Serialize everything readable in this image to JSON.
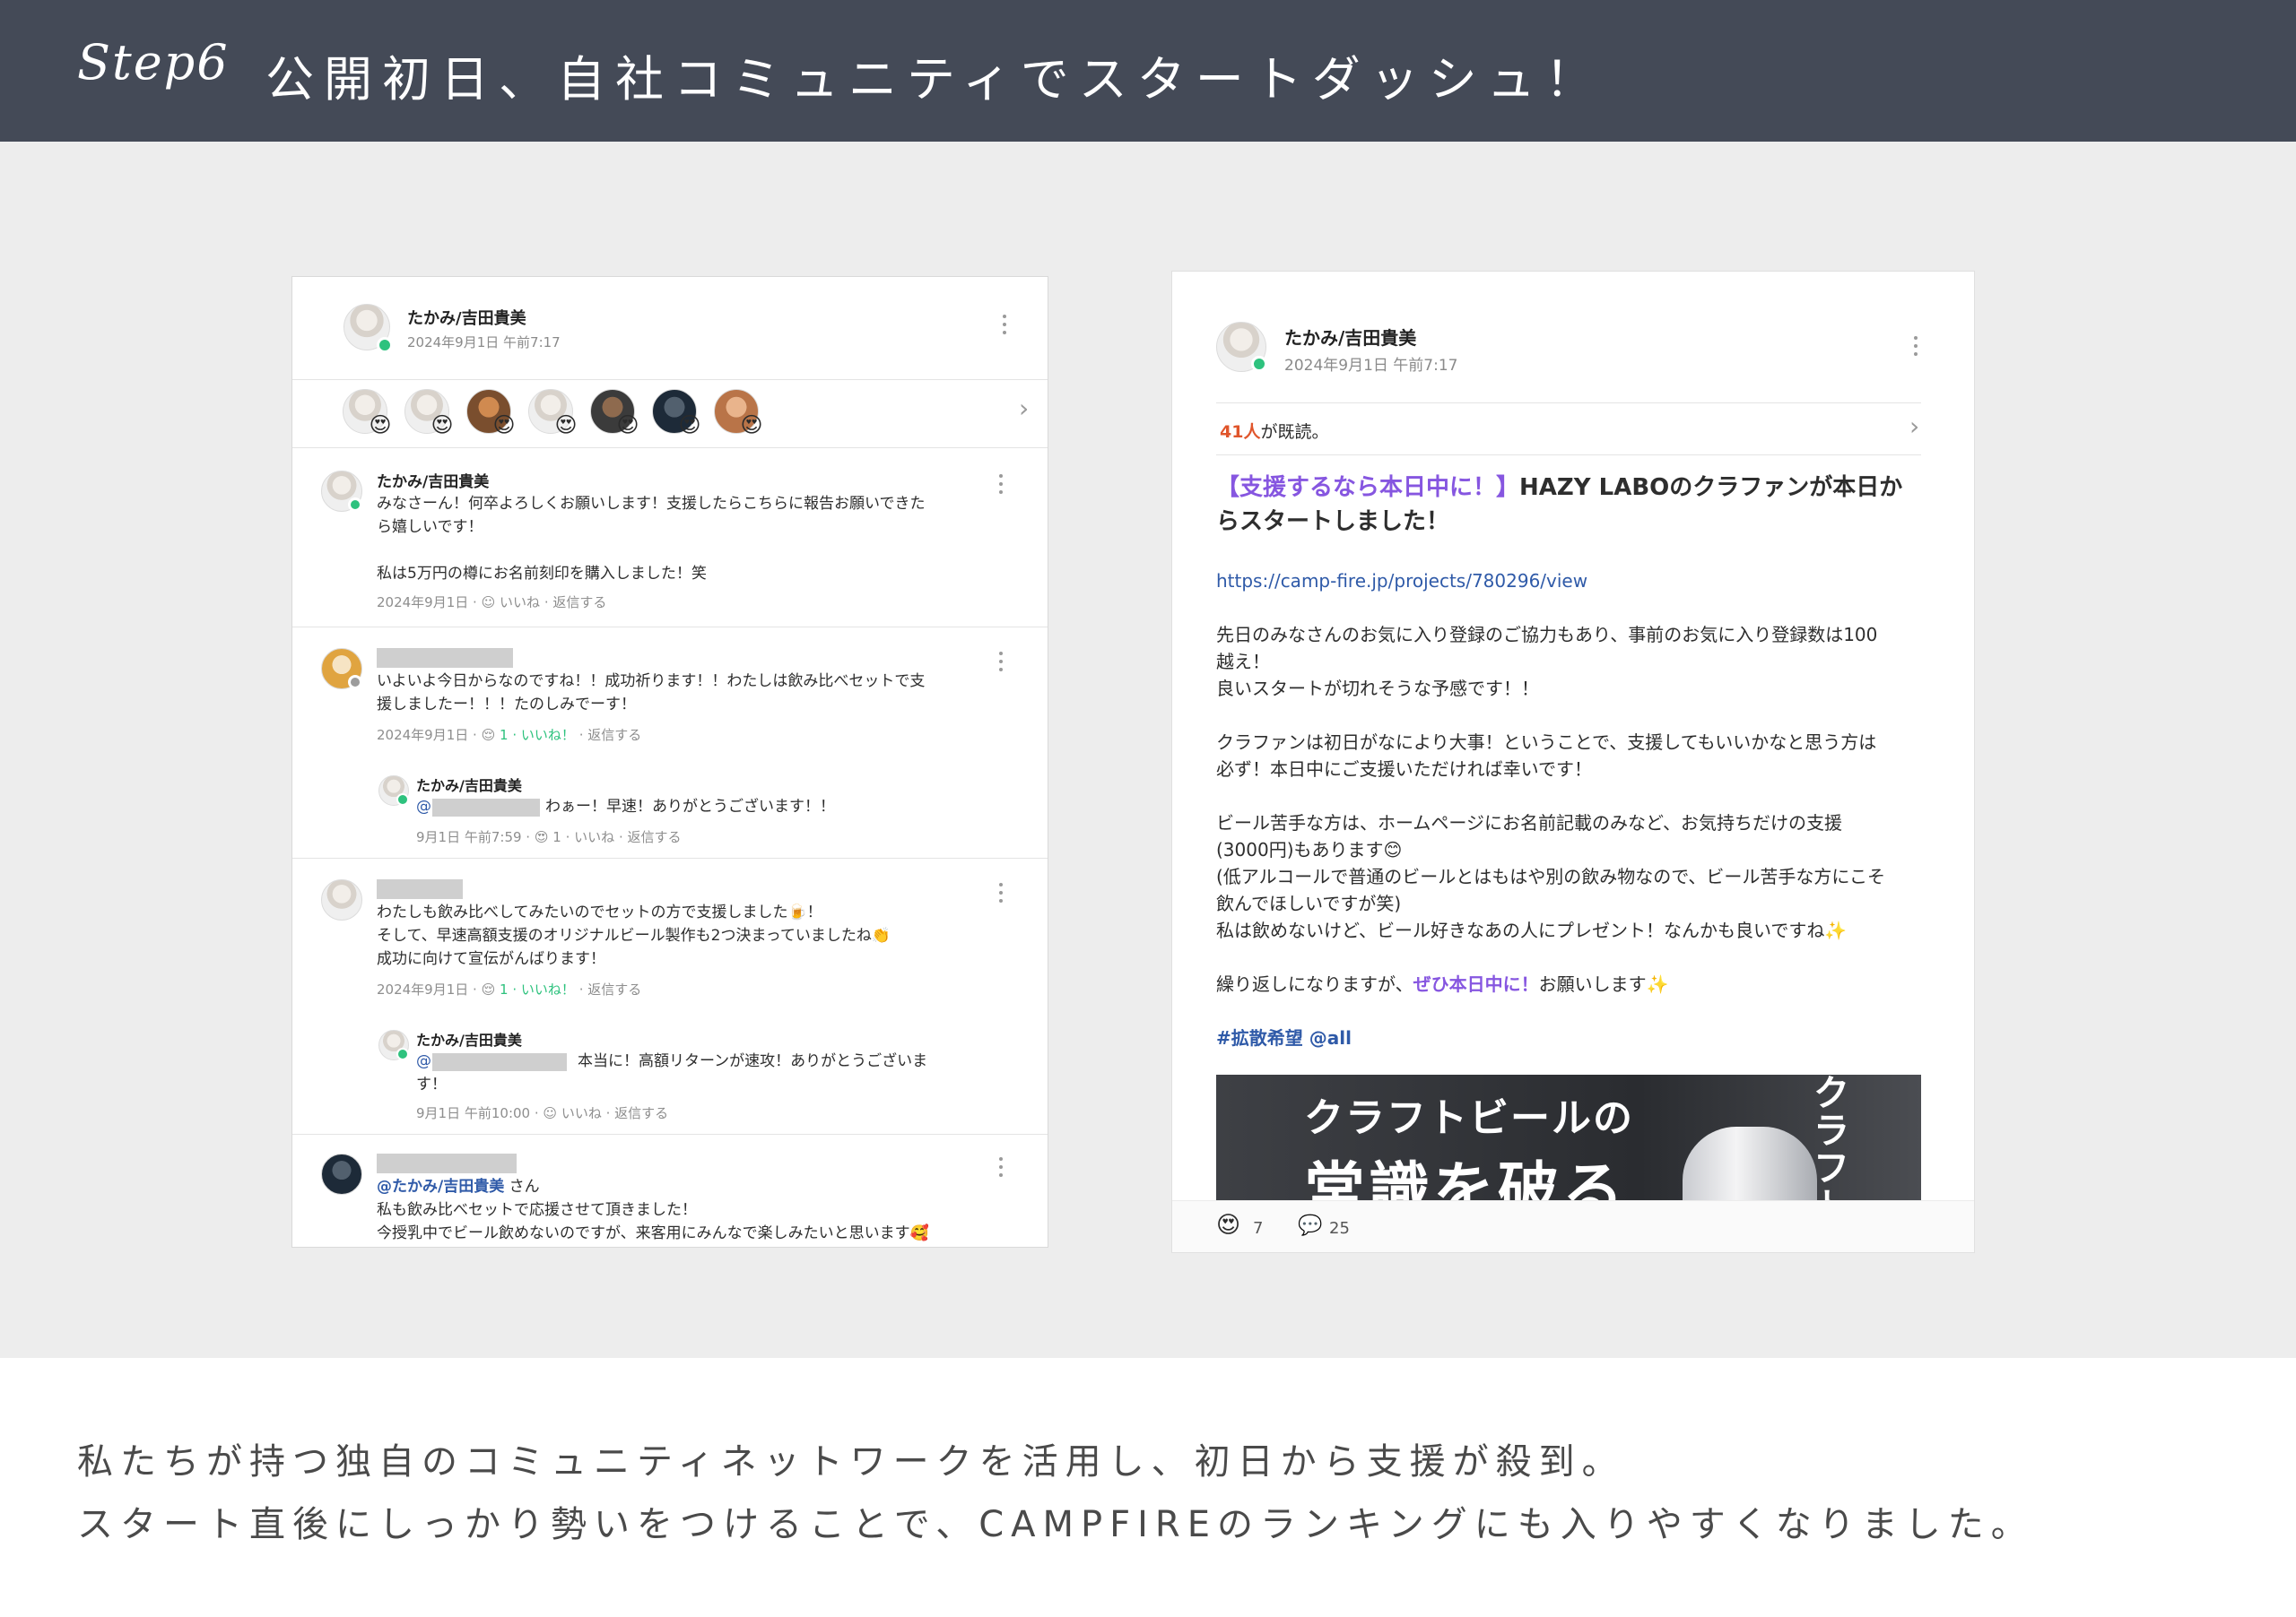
{
  "header": {
    "step": "Step6",
    "title": "公開初日、自社コミュニティでスタートダッシュ！"
  },
  "left_post": {
    "author": "たかみ/吉田貴美",
    "time": "2024年9月1日 午前7:17",
    "reactions_emoji": "😍",
    "comments": [
      {
        "author": "たかみ/吉田貴美",
        "text1": "みなさーん！何卒よろしくお願いします！支援したらこちらに報告お願いできた",
        "text2": "ら嬉しいです！",
        "text3": "私は5万円の樽にお名前刻印を購入しました！笑",
        "meta_date": "2024年9月1日 ·",
        "meta_like": "いいね",
        "meta_reply": "· 返信する"
      },
      {
        "text1": "いよいよ今日からなのですね！！成功祈ります！！わたしは飲み比べセットで支",
        "text2": "援しましたー！！！たのしみでーす！",
        "meta_date": "2024年9月1日 ·",
        "meta_count": "1 ·",
        "meta_like": "いいね！",
        "meta_reply": "· 返信する",
        "reply": {
          "author": "たかみ/吉田貴美",
          "at": "@",
          "text": "わぁー！早速！ありがとうございます！！",
          "meta_date": "9月1日 午前7:59 ·",
          "meta_count": "1 ·",
          "meta_like": "いいね",
          "meta_reply": "· 返信する"
        }
      },
      {
        "text1": "わたしも飲み比べしてみたいのでセットの方で支援しました🍺！",
        "text2": "そして、早速高額支援のオリジナルビール製作も2つ決まっていましたね👏",
        "text3": "成功に向けて宣伝がんばります！",
        "meta_date": "2024年9月1日 ·",
        "meta_count": "1 ·",
        "meta_like": "いいね！",
        "meta_reply": "· 返信する",
        "reply": {
          "author": "たかみ/吉田貴美",
          "at": "@",
          "text": "本当に！高額リターンが速攻！ありがとうございま",
          "text2": "す！",
          "meta_date": "9月1日 午前10:00 ·",
          "meta_like": "いいね",
          "meta_reply": "· 返信する"
        }
      },
      {
        "mention": "@たかみ/吉田貴美",
        "mention_suffix": " さん",
        "text1": "私も飲み比べセットで応援させて頂きました！",
        "text2": "今授乳中でビール飲めないのですが、来客用にみんなで楽しみたいと思います🥰"
      }
    ]
  },
  "right_post": {
    "author": "たかみ/吉田貴美",
    "time": "2024年9月1日 午前7:17",
    "read_count": "41人",
    "read_suffix": "が既読。",
    "headline_purple": "【支援するなら本日中に！】",
    "headline_rest1": "HAZY LABOのクラファンが本日か",
    "headline_rest2": "らスタートしました！",
    "url": "https://camp-fire.jp/projects/780296/view",
    "p1a": "先日のみなさんのお気に入り登録のご協力もあり、事前のお気に入り登録数は100",
    "p1b": "越え！",
    "p1c": "良いスタートが切れそうな予感です！！",
    "p2a": "クラファンは初日がなにより大事！ということで、支援してもいいかなと思う方は",
    "p2b": "必ず！本日中にご支援いただければ幸いです！",
    "p3a": "ビール苦手な方は、ホームページにお名前記載のみなど、お気持ちだけの支援",
    "p3b": "(3000円)もあります😊",
    "p3c": "(低アルコールで普通のビールとはもはや別の飲み物なので、ビール苦手な方にこそ",
    "p3d": "飲んでほしいですが笑)",
    "p3e": "私は飲めないけど、ビール好きなあの人にプレゼント！なんかも良いですね✨",
    "p4_pre": "繰り返しになりますが、",
    "p4_purple": "ぜひ本日中に！",
    "p4_post": "お願いします✨",
    "hashtags": "#拡散希望 @all",
    "banner_line1": "クラフトビールの",
    "banner_line2": "常識を破る",
    "banner_vertical": "クラフト",
    "reaction_emoji": "😍",
    "reaction_count": "7",
    "comment_count": "25"
  },
  "caption": {
    "line1": "私たちが持つ独自のコミュニティネットワークを活用し、初日から支援が殺到。",
    "line2": "スタート直後にしっかり勢いをつけることで、CAMPFIREのランキングにも入りやすくなりました。"
  }
}
